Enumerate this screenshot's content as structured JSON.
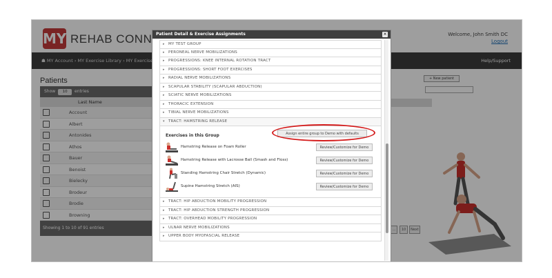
{
  "app": {
    "logo_mark": "MY",
    "logo_text": "REHAB CONNECTION",
    "welcome": "Welcome, John Smith DC",
    "logout": "Logout",
    "help": "Help/Support",
    "breadcrumb": "MY Account  ›  MY Exercise Library  ›  MY Exercise G"
  },
  "patients": {
    "title": "Patients",
    "show_label": "Show",
    "show_value": "10",
    "entries_label": "entries",
    "column_last_name": "Last Name",
    "rows": [
      "Account",
      "Albert",
      "Antonides",
      "Athos",
      "Bauer",
      "Benoist",
      "Bielecky",
      "Brodeur",
      "Brodie",
      "Browning"
    ],
    "footer": "Showing 1 to 10 of 91 entries"
  },
  "right_panel": {
    "new_patient": "+ New patient",
    "pager_ellipsis": "...",
    "pager_last": "10",
    "pager_next": "Next"
  },
  "modal": {
    "title": "Patient Detail & Exercise Assignments",
    "close": "×",
    "groups_before": [
      "MY TEST GROUP",
      "PERONEAL NERVE MOBILIZATIONS",
      "PROGRESSIONS: KNEE INTERNAL ROTATION TRACT",
      "PROGRESSIONS: SHORT FOOT EXERCISES",
      "RADIAL NERVE MOBILIZATIONS",
      "SCAPULAR STABILITY (SCAPULAR ABDUCTION)",
      "SCIATIC NERVE MOBILIZATIONS",
      "THORACIC EXTENSION",
      "TIBIAL NERVE MOBILIZATIONS"
    ],
    "open_group": "TRACT: HAMSTRING RELEASE",
    "exercises_heading": "Exercises in this Group",
    "assign_all": "Assign entire group to Demo with defaults",
    "exercises": [
      {
        "name": "Hamstring Release on Foam Roller",
        "button": "Review/Customize for Demo"
      },
      {
        "name": "Hamstring Release with Lacrosse Ball (Smash and Floss)",
        "button": "Review/Customize for Demo"
      },
      {
        "name": "Standing Hamstring Chair Stretch (Dynamic)",
        "button": "Review/Customize for Demo"
      },
      {
        "name": "Supine Hamstring Stretch (AIS)",
        "button": "Review/Customize for Demo"
      }
    ],
    "groups_after": [
      "TRACT: HIP ABDUCTION MOBILITY PROGRESSION",
      "TRACT: HIP ABDUCTION STRENGTH PROGRESSION",
      "TRACT: OVERHEAD MOBILITY PROGRESSION",
      "ULNAR NERVE MOBILIZATIONS",
      "UPPER BODY MYOFASCIAL RELEASE"
    ]
  },
  "colors": {
    "brand": "#c33b3b",
    "nav": "#3d3d3d",
    "highlight": "#d41c1c"
  }
}
